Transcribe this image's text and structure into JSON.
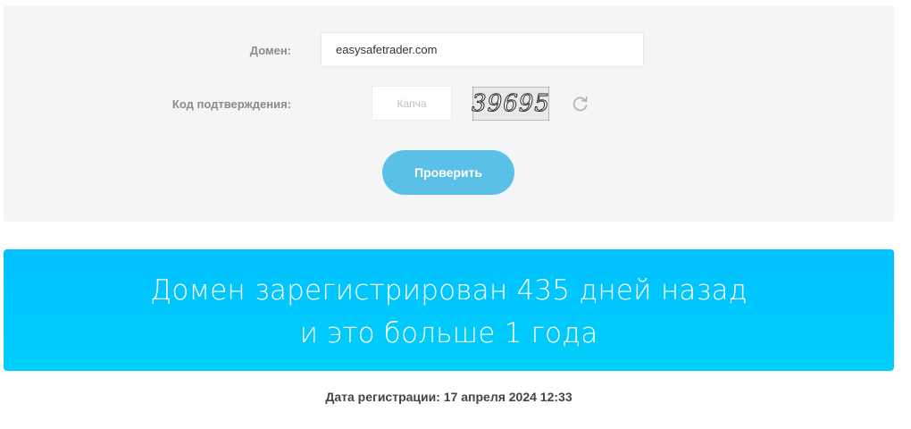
{
  "form": {
    "domain_label": "Домен:",
    "domain_value": "easysafetrader.com",
    "captcha_label": "Код подтверждения:",
    "captcha_placeholder": "Капча",
    "captcha_code": "39695",
    "refresh_icon": "refresh-icon",
    "check_button_label": "Проверить",
    "accent_color": "#5bc0e8"
  },
  "result": {
    "line1": "Домен зарегистрирован 435 дней назад",
    "line2": "и это больше 1 года",
    "banner_color": "#00c6fd"
  },
  "registration": {
    "text": "Дата регистрации: 17 апреля 2024 12:33"
  }
}
